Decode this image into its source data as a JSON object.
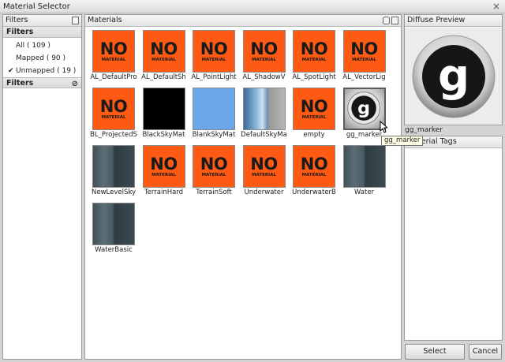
{
  "window": {
    "title": "Material Selector",
    "close_glyph": "×"
  },
  "left_panel": {
    "header": "Filters",
    "filters_section": "Filters",
    "items": [
      {
        "label": "All ( 109 )",
        "checked": false
      },
      {
        "label": "Mapped ( 90 )",
        "checked": false
      },
      {
        "label": "Unmapped ( 19 )",
        "checked": true
      }
    ],
    "filters_section2": "Filters",
    "check_glyph": "✔",
    "no_glyph": "⊘"
  },
  "materials_panel": {
    "header": "Materials",
    "items": [
      {
        "label": "AL_DefaultPro",
        "thumb": "nomat"
      },
      {
        "label": "AL_DefaultSh",
        "thumb": "nomat"
      },
      {
        "label": "AL_PointLight",
        "thumb": "nomat"
      },
      {
        "label": "AL_ShadowV",
        "thumb": "nomat"
      },
      {
        "label": "AL_SpotLight",
        "thumb": "nomat"
      },
      {
        "label": "AL_VectorLig",
        "thumb": "nomat"
      },
      {
        "label": "BL_ProjectedS",
        "thumb": "nomat"
      },
      {
        "label": "BlackSkyMat",
        "thumb": "black"
      },
      {
        "label": "BlankSkyMat",
        "thumb": "blue"
      },
      {
        "label": "DefaultSkyMa",
        "thumb": "sky"
      },
      {
        "label": "empty",
        "thumb": "nomat"
      },
      {
        "label": "gg_marker",
        "thumb": "gg"
      },
      {
        "label": "NewLevelSky",
        "thumb": "water"
      },
      {
        "label": "TerrainHard",
        "thumb": "nomat"
      },
      {
        "label": "TerrainSoft",
        "thumb": "nomat"
      },
      {
        "label": "Underwater",
        "thumb": "nomat"
      },
      {
        "label": "UnderwaterB",
        "thumb": "nomat"
      },
      {
        "label": "Water",
        "thumb": "water"
      },
      {
        "label": "WaterBasic",
        "thumb": "water"
      }
    ],
    "nomat_big": "NO",
    "nomat_small": "MATERIAL",
    "tooltip": "gg_marker"
  },
  "right_panel": {
    "preview_header": "Diffuse Preview",
    "preview_name": "gg_marker",
    "tags_header": "Material Tags"
  },
  "buttons": {
    "select": "Select",
    "cancel": "Cancel"
  },
  "colors": {
    "no_material": "#ff5a14",
    "panel_bg": "#d4d4d4"
  }
}
